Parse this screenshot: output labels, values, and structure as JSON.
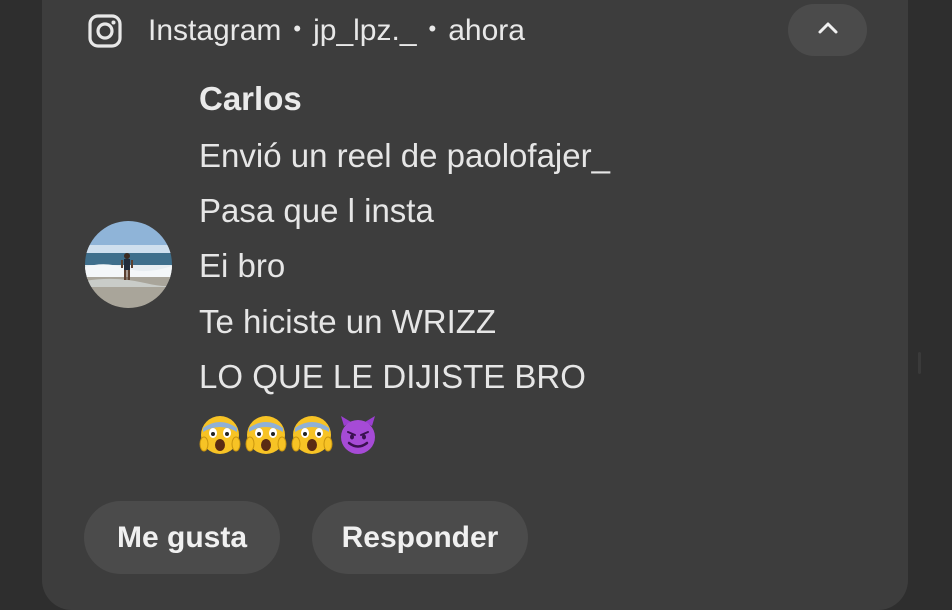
{
  "notification": {
    "app": "Instagram",
    "separator": "•",
    "account": "jp_lpz._",
    "time": "ahora",
    "sender": "Carlos",
    "messages": [
      "Envió un reel de paolofajer_",
      "Pasa que l insta",
      "Ei bro",
      "Te hiciste un WRIZZ",
      "LO QUE LE DIJISTE BRO"
    ],
    "emojis": [
      "screaming-face",
      "screaming-face",
      "screaming-face",
      "smiling-face-with-horns"
    ],
    "actions": {
      "like": "Me gusta",
      "reply": "Responder"
    }
  },
  "icons": {
    "app_icon": "instagram-icon",
    "collapse": "chevron-up-icon"
  },
  "colors": {
    "background": "#2e2e2e",
    "card": "#3d3d3d",
    "button": "#4b4b4b",
    "text": "#e8e8e8"
  }
}
